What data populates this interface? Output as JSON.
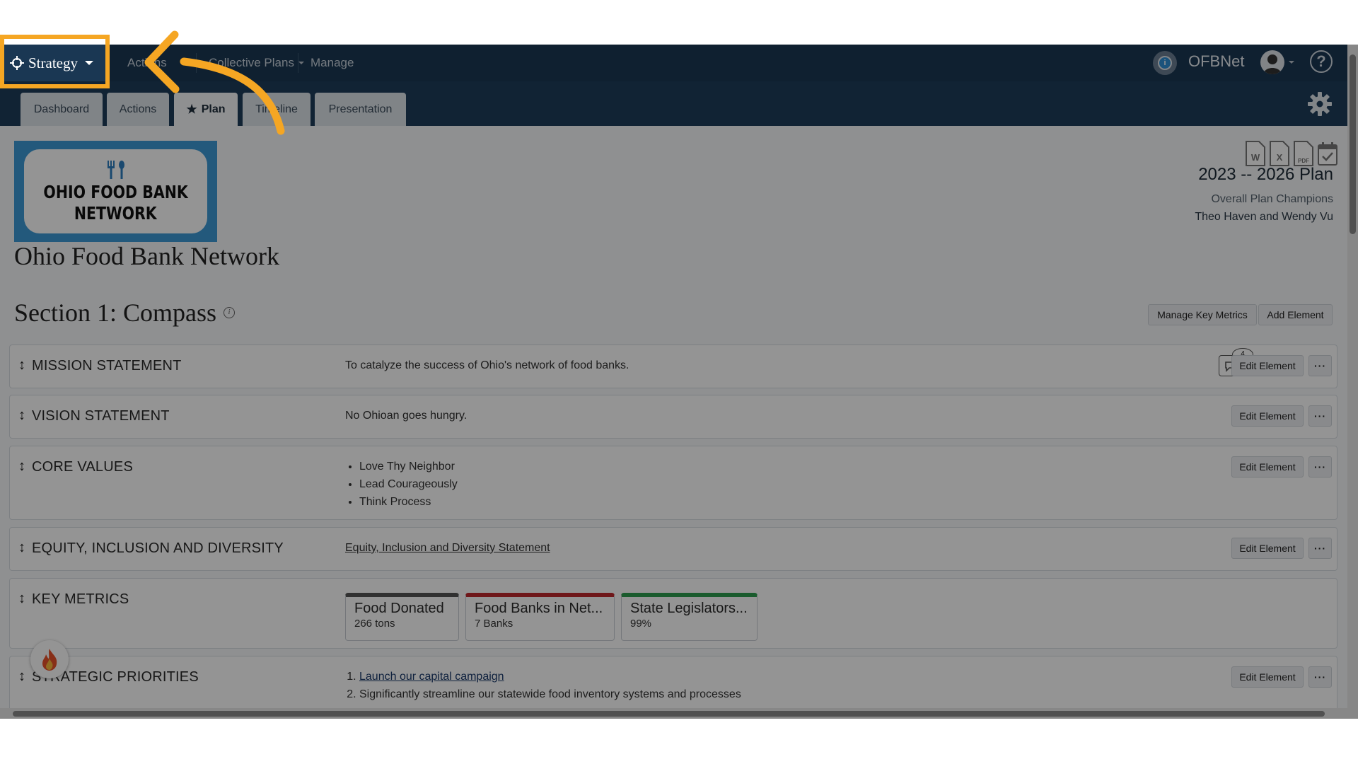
{
  "nav": {
    "strategy_label": "Strategy",
    "actions_label": "Actions",
    "collective_label": "Collective Plans",
    "manage_label": "Manage",
    "network_name": "OFBNet",
    "help_glyph": "?"
  },
  "tabs": [
    {
      "label": "Dashboard"
    },
    {
      "label": "Actions"
    },
    {
      "label": "Plan"
    },
    {
      "label": "Timeline"
    },
    {
      "label": "Presentation"
    }
  ],
  "org": {
    "logo_line1": "OHIO FOOD BANK",
    "logo_line2": "NETWORK",
    "title": "Ohio Food Bank Network"
  },
  "plan": {
    "range": "2023 -- 2026 Plan",
    "champions_label": "Overall Plan Champions",
    "champions_names": "Theo Haven and Wendy Vu",
    "export_icons": [
      "word-icon",
      "excel-icon",
      "pdf-icon",
      "calendar-check-icon"
    ]
  },
  "section": {
    "title": "Section 1: Compass",
    "manage_metrics_label": "Manage Key Metrics",
    "add_element_label": "Add Element"
  },
  "elements": {
    "edit_label": "Edit Element",
    "more_label": "···",
    "mission": {
      "label": "MISSION STATEMENT",
      "text": "To catalyze the success of Ohio's network of food banks.",
      "comment_count": "4"
    },
    "vision": {
      "label": "VISION STATEMENT",
      "text": "No Ohioan goes hungry."
    },
    "core_values": {
      "label": "CORE VALUES",
      "items": [
        "Love Thy Neighbor",
        "Lead Courageously",
        "Think Process"
      ]
    },
    "equity": {
      "label": "EQUITY, INCLUSION AND DIVERSITY",
      "link": "Equity, Inclusion and Diversity Statement"
    },
    "key_metrics": {
      "label": "KEY METRICS",
      "metrics": [
        {
          "name": "Food Donated",
          "value": "266 tons",
          "color": "#555555"
        },
        {
          "name": "Food Banks in Net...",
          "value": "7 Banks",
          "color": "#c0282d"
        },
        {
          "name": "State Legislators...",
          "value": "99%",
          "color": "#2e9e4f"
        }
      ]
    },
    "priorities": {
      "label": "STRATEGIC PRIORITIES",
      "items": [
        "Launch our capital campaign",
        "Significantly streamline our statewide food inventory systems and processes"
      ]
    }
  },
  "colors": {
    "nav_bg": "#1a3753",
    "tab_bar_bg": "#1e3d5b",
    "highlight": "#f5a623",
    "logo_blue": "#3d9ad6"
  }
}
